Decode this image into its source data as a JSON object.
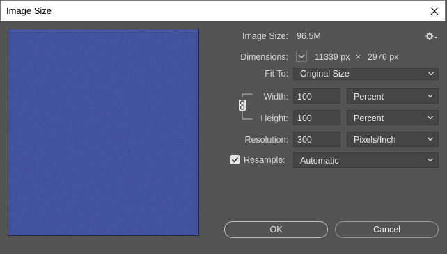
{
  "window": {
    "title": "Image Size"
  },
  "image_size": {
    "label": "Image Size:",
    "value": "96.5M"
  },
  "dimensions": {
    "label": "Dimensions:",
    "width": "11339 px",
    "times": "×",
    "height": "2976 px"
  },
  "fit_to": {
    "label": "Fit To:",
    "value": "Original Size"
  },
  "width": {
    "label": "Width:",
    "value": "100",
    "unit": "Percent"
  },
  "height": {
    "label": "Height:",
    "value": "100",
    "unit": "Percent"
  },
  "resolution": {
    "label": "Resolution:",
    "value": "300",
    "unit": "Pixels/Inch"
  },
  "resample": {
    "label": "Resample:",
    "checked": true,
    "value": "Automatic"
  },
  "buttons": {
    "ok": "OK",
    "cancel": "Cancel"
  },
  "colors": {
    "preview_fill": "#2f3f8e",
    "dialog_bg": "#535353",
    "field_bg": "#454545"
  },
  "icons": [
    "close-icon",
    "gear-icon",
    "chevron-down-icon",
    "chain-link-icon",
    "checkmark-icon"
  ]
}
